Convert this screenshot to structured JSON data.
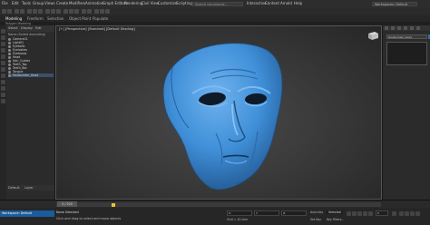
{
  "menubar": {
    "items": [
      "File",
      "Edit",
      "Tools",
      "Group",
      "Views",
      "Create",
      "Modifiers",
      "Animation",
      "Graph Editors",
      "Rendering",
      "Civil View",
      "Customize",
      "Scripting",
      "Interactive",
      "Content",
      "Arnold",
      "Help"
    ],
    "search_placeholder": "Search commands...",
    "workspace": "Workspaces: Default"
  },
  "ribbon": {
    "tabs": [
      "Modeling",
      "Freeform",
      "Selection",
      "Object Paint",
      "Populate"
    ],
    "active": "Modeling",
    "sub_label": "Polygon Modeling"
  },
  "explorer": {
    "tabs": [
      "Select",
      "Display",
      "Edit"
    ],
    "header": "Name (Sorted Ascending)",
    "rows": [
      "Camera01",
      "Light01",
      "Eyeballs",
      "Eyelashes",
      "Eyebrows",
      "Head",
      "Hair_Guides",
      "Teeth_Top",
      "Teeth_Bot",
      "Tongue",
      "Facebuilder_Head"
    ],
    "selected_index": 10,
    "bottom": [
      "Default",
      "Layer"
    ]
  },
  "viewport": {
    "label": "[+] [Perspective] [Standard] [Default Shading]"
  },
  "cmdpanel": {
    "field": "facebuilder_head",
    "field_color": "#2a6fc4"
  },
  "timeline": {
    "slider_label": "0 / 100",
    "key_color": "#e8c42a"
  },
  "statusbar": {
    "workspace": "Workspace: Default",
    "selection": "None Selected",
    "hint": "Click and drag to select and move objects",
    "x": "X:",
    "y": "Y:",
    "z": "Z:",
    "grid": "Grid = 10.0cm",
    "auto_key": "Auto Key",
    "selected": "Selected",
    "set_key": "Set Key",
    "key_filters": "Key Filters...",
    "time": "0",
    "accent": "#1a5c9c"
  },
  "colors": {
    "face": "#3f8fd8",
    "face_shadow": "#1f4f80",
    "face_highlight": "#7cbaf0"
  }
}
